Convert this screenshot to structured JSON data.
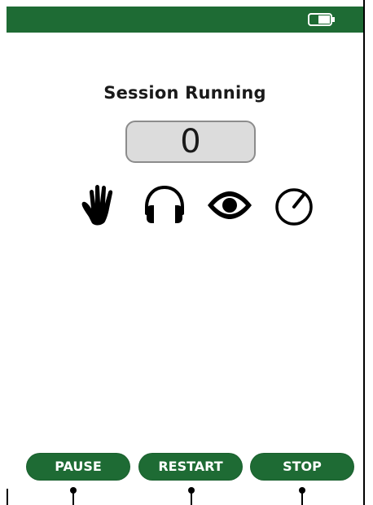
{
  "header": {
    "battery_icon": "battery-icon",
    "accent_color": "#1e6b34"
  },
  "session": {
    "title": "Session Running",
    "counter_value": "0"
  },
  "status_icons": [
    "hand-icon",
    "headphones-icon",
    "eye-icon",
    "gauge-icon"
  ],
  "controls": {
    "pause_label": "PAUSE",
    "restart_label": "RESTART",
    "stop_label": "STOP"
  }
}
